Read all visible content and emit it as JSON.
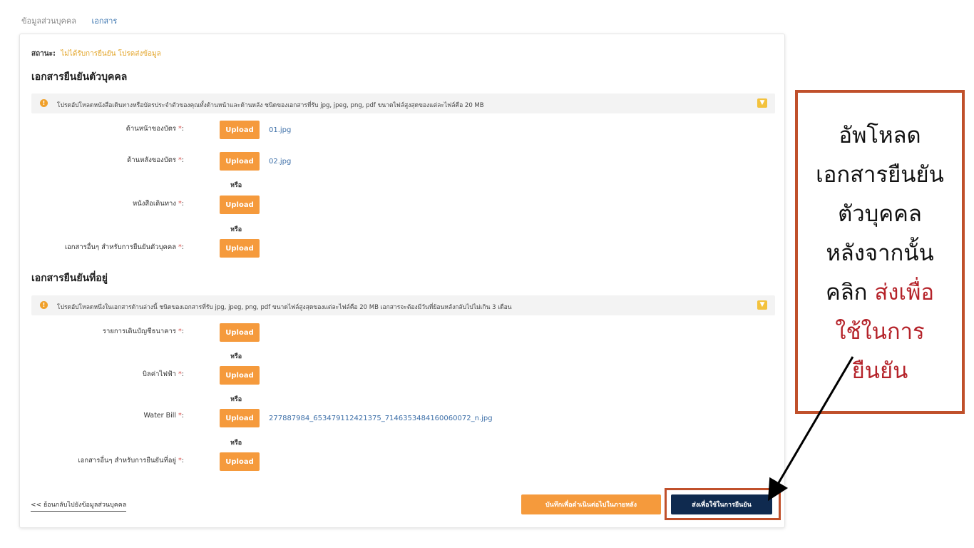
{
  "tabs": {
    "personal": "ข้อมูลส่วนบุคคล",
    "documents": "เอกสาร"
  },
  "status": {
    "label": "สถานะ:",
    "value": "ไม่ได้รับการยืนยัน โปรดส่งข้อมูล"
  },
  "identity": {
    "title": "เอกสารยืนยันตัวบุคคล",
    "notice": "โปรดอัปโหลดหนังสือเดินทางหรือบัตรประจำตัวของคุณทั้งด้านหน้าและด้านหลัง ชนิดของเอกสารที่รับ jpg, jpeg, png, pdf ขนาดไฟล์สูงสุดของแต่ละไฟล์คือ 20 MB",
    "rows": [
      {
        "label": "ด้านหน้าของบัตร",
        "file": "01.jpg"
      },
      {
        "label": "ด้านหลังของบัตร",
        "file": "02.jpg"
      },
      {
        "label": "หนังสือเดินทาง",
        "file": ""
      },
      {
        "label": "เอกสารอื่นๆ สำหรับการยืนยันตัวบุคคล",
        "file": ""
      }
    ]
  },
  "address": {
    "title": "เอกสารยืนยันที่อยู่",
    "notice": "โปรดอัปโหลดหนึ่งในเอกสารด้านล่างนี้ ชนิดของเอกสารที่รับ jpg, jpeg, png, pdf ขนาดไฟล์สูงสุดของแต่ละไฟล์คือ 20 MB เอกสารจะต้องมีวันที่ย้อนหลังกลับไปไม่เกิน 3 เดือน",
    "rows": [
      {
        "label": "รายการเดินบัญชีธนาคาร",
        "file": ""
      },
      {
        "label": "บิลค่าไฟฟ้า",
        "file": ""
      },
      {
        "label": "Water Bill",
        "file": "277887984_653479112421375_7146353484160060072_n.jpg"
      },
      {
        "label": "เอกสารอื่นๆ สำหรับการยืนยันที่อยู่",
        "file": ""
      }
    ]
  },
  "common": {
    "upload": "Upload",
    "or": "หรือ",
    "required": "*",
    "colon": ":"
  },
  "footer": {
    "back": "<< ย้อนกลับไปยังข้อมูลส่วนบุคคล",
    "save": "บันทึกเพื่อดำเนินต่อไปในภายหลัง",
    "submit": "ส่งเพื่อใช้ในการยืนยัน"
  },
  "callout": {
    "line1": "อัพโหลด",
    "line2": "เอกสารยืนยัน",
    "line3": "ตัวบุคคล",
    "line4": "หลังจากนั้น",
    "line5_plain": "คลิก ",
    "line5_red": "ส่งเพื่อ",
    "line6": "ใช้ในการ",
    "line7": "ยืนยัน"
  },
  "colors": {
    "accent_orange": "#f59a3c",
    "navy": "#0f2a4f",
    "highlight": "#c0502b",
    "callout_red": "#b5232a"
  }
}
